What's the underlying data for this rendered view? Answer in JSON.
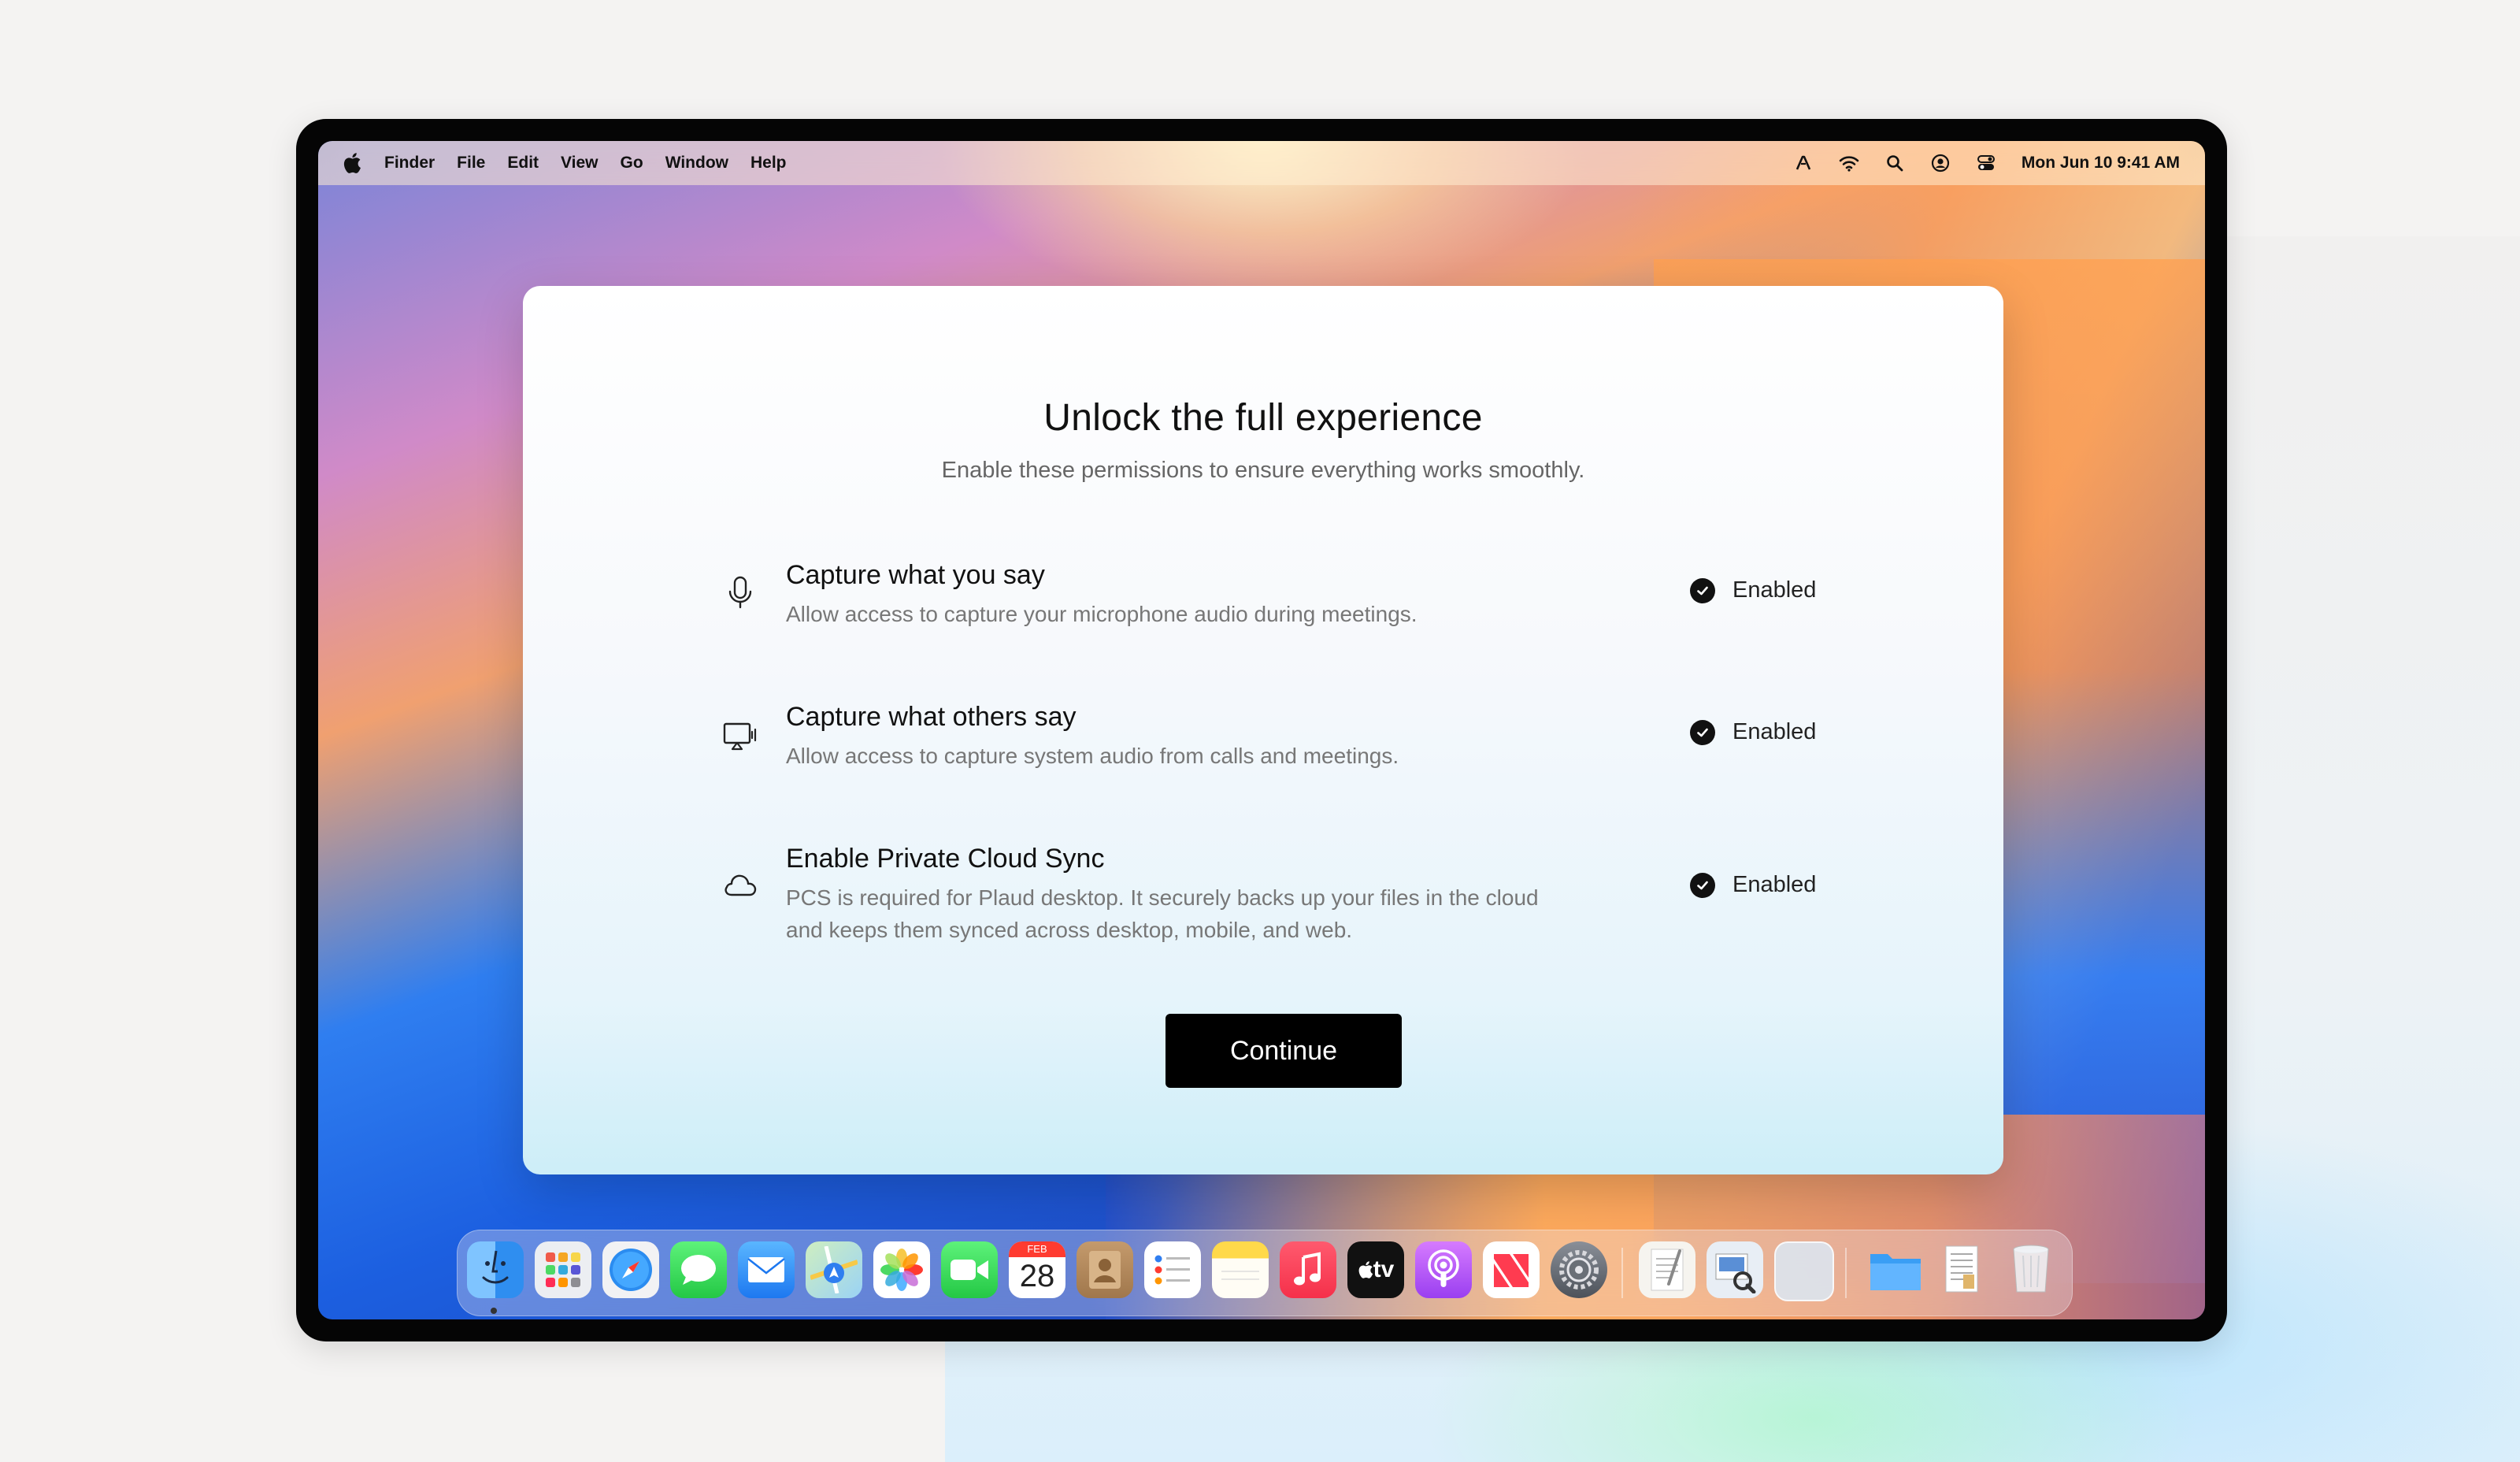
{
  "menubar": {
    "app_name": "Finder",
    "items": [
      "File",
      "Edit",
      "View",
      "Go",
      "Window",
      "Help"
    ],
    "status_icons": [
      "font-icon",
      "wifi-icon",
      "search-icon",
      "user-icon",
      "control-center-icon"
    ],
    "clock": "Mon Jun 10  9:41 AM"
  },
  "dialog": {
    "title": "Unlock the full experience",
    "subtitle": "Enable these permissions to ensure everything works smoothly.",
    "permissions": [
      {
        "icon": "microphone-icon",
        "title": "Capture what you say",
        "description": "Allow access to capture your microphone audio during meetings.",
        "status": "Enabled"
      },
      {
        "icon": "screen-audio-icon",
        "title": "Capture what others say",
        "description": "Allow access to capture system audio from calls and meetings.",
        "status": "Enabled"
      },
      {
        "icon": "cloud-icon",
        "title": "Enable Private Cloud Sync",
        "description": "PCS is required for Plaud desktop. It securely backs up your files in the cloud and keeps them synced across desktop, mobile, and web.",
        "status": "Enabled"
      }
    ],
    "continue_label": "Continue"
  },
  "dock": {
    "apps": [
      "Finder",
      "Launchpad",
      "Safari",
      "Messages",
      "Mail",
      "Maps",
      "Photos",
      "FaceTime",
      "Calendar",
      "Contacts",
      "Reminders",
      "Notes",
      "Music",
      "TV",
      "Podcasts",
      "News",
      "System Settings",
      "TextEdit",
      "Preview",
      "Window",
      "Folder",
      "Document",
      "Trash"
    ],
    "calendar_month": "FEB",
    "calendar_day": "28",
    "tv_label": "tv"
  },
  "colors": {
    "accent": "#000000",
    "dialog_text": "#111111",
    "muted_text": "#777777"
  }
}
